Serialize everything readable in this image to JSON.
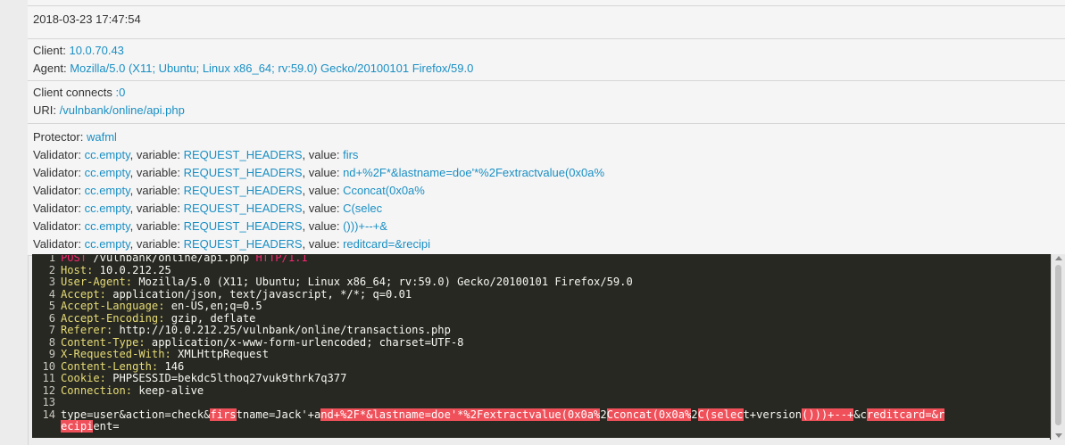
{
  "timestamp": "2018-03-23 17:47:54",
  "client": {
    "label": "Client: ",
    "value": "10.0.70.43"
  },
  "agent": {
    "label": "Agent: ",
    "value": "Mozilla/5.0 (X11; Ubuntu; Linux x86_64; rv:59.0) Gecko/20100101 Firefox/59.0"
  },
  "connects": {
    "label": "Client connects ",
    "value": ":0"
  },
  "uri": {
    "label": "URI: ",
    "value": "/vulnbank/online/api.php"
  },
  "protector": {
    "label": "Protector: ",
    "value": "wafml"
  },
  "validators": [
    {
      "label": "Validator: ",
      "name": "cc.empty",
      "var_label": ", variable: ",
      "variable": "REQUEST_HEADERS",
      "val_label": ", value: ",
      "value": "firs"
    },
    {
      "label": "Validator: ",
      "name": "cc.empty",
      "var_label": ", variable: ",
      "variable": "REQUEST_HEADERS",
      "val_label": ", value: ",
      "value": "nd+%2F*&lastname=doe'*%2Fextractvalue(0x0a%"
    },
    {
      "label": "Validator: ",
      "name": "cc.empty",
      "var_label": ", variable: ",
      "variable": "REQUEST_HEADERS",
      "val_label": ", value: ",
      "value": "Cconcat(0x0a%"
    },
    {
      "label": "Validator: ",
      "name": "cc.empty",
      "var_label": ", variable: ",
      "variable": "REQUEST_HEADERS",
      "val_label": ", value: ",
      "value": "C(selec"
    },
    {
      "label": "Validator: ",
      "name": "cc.empty",
      "var_label": ", variable: ",
      "variable": "REQUEST_HEADERS",
      "val_label": ", value: ",
      "value": "()))+--+&"
    },
    {
      "label": "Validator: ",
      "name": "cc.empty",
      "var_label": ", variable: ",
      "variable": "REQUEST_HEADERS",
      "val_label": ", value: ",
      "value": "reditcard=&recipi"
    }
  ],
  "request": {
    "line1": {
      "method": "POST",
      "path": " /vulnbank/online/api.php ",
      "proto": "HTTP/1.1"
    },
    "headers": [
      {
        "n": "2",
        "key": "Host:",
        "value": " 10.0.212.25"
      },
      {
        "n": "3",
        "key": "User-Agent:",
        "value": " Mozilla/5.0 (X11; Ubuntu; Linux x86_64; rv:59.0) Gecko/20100101 Firefox/59.0"
      },
      {
        "n": "4",
        "key": "Accept:",
        "value": " application/json, text/javascript, */*; q=0.01"
      },
      {
        "n": "5",
        "key": "Accept-Language:",
        "value": " en-US,en;q=0.5"
      },
      {
        "n": "6",
        "key": "Accept-Encoding:",
        "value": " gzip, deflate"
      },
      {
        "n": "7",
        "key": "Referer:",
        "value": " http://10.0.212.25/vulnbank/online/transactions.php"
      },
      {
        "n": "8",
        "key": "Content-Type:",
        "value": " application/x-www-form-urlencoded; charset=UTF-8"
      },
      {
        "n": "9",
        "key": "X-Requested-With:",
        "value": " XMLHttpRequest"
      },
      {
        "n": "10",
        "key": "Content-Length:",
        "value": " 146"
      },
      {
        "n": "11",
        "key": "Cookie:",
        "value": " PHPSESSID=bekdc5lthoq27vuk9thrk7q377"
      },
      {
        "n": "12",
        "key": "Connection:",
        "value": " keep-alive"
      }
    ],
    "line_numbers": {
      "l1": "1",
      "l13": "13",
      "l14": "14"
    },
    "body_parts": [
      {
        "t": "type=user&action=check&",
        "h": false
      },
      {
        "t": "firs",
        "h": true
      },
      {
        "t": "tname=Jack'+a",
        "h": false
      },
      {
        "t": "nd+%2F*&lastname=doe'*%2Fextractvalue(0x0a%",
        "h": true
      },
      {
        "t": "2",
        "h": false
      },
      {
        "t": "Cconcat(0x0a%",
        "h": true
      },
      {
        "t": "2",
        "h": false
      },
      {
        "t": "C(selec",
        "h": true
      },
      {
        "t": "t+version",
        "h": false
      },
      {
        "t": "()))+--+",
        "h": true
      },
      {
        "t": "&c",
        "h": false
      },
      {
        "t": "reditcard=&r",
        "h": true
      }
    ],
    "body_wrap": [
      {
        "t": "ecipi",
        "h": true
      },
      {
        "t": "ent=",
        "h": false
      }
    ]
  }
}
